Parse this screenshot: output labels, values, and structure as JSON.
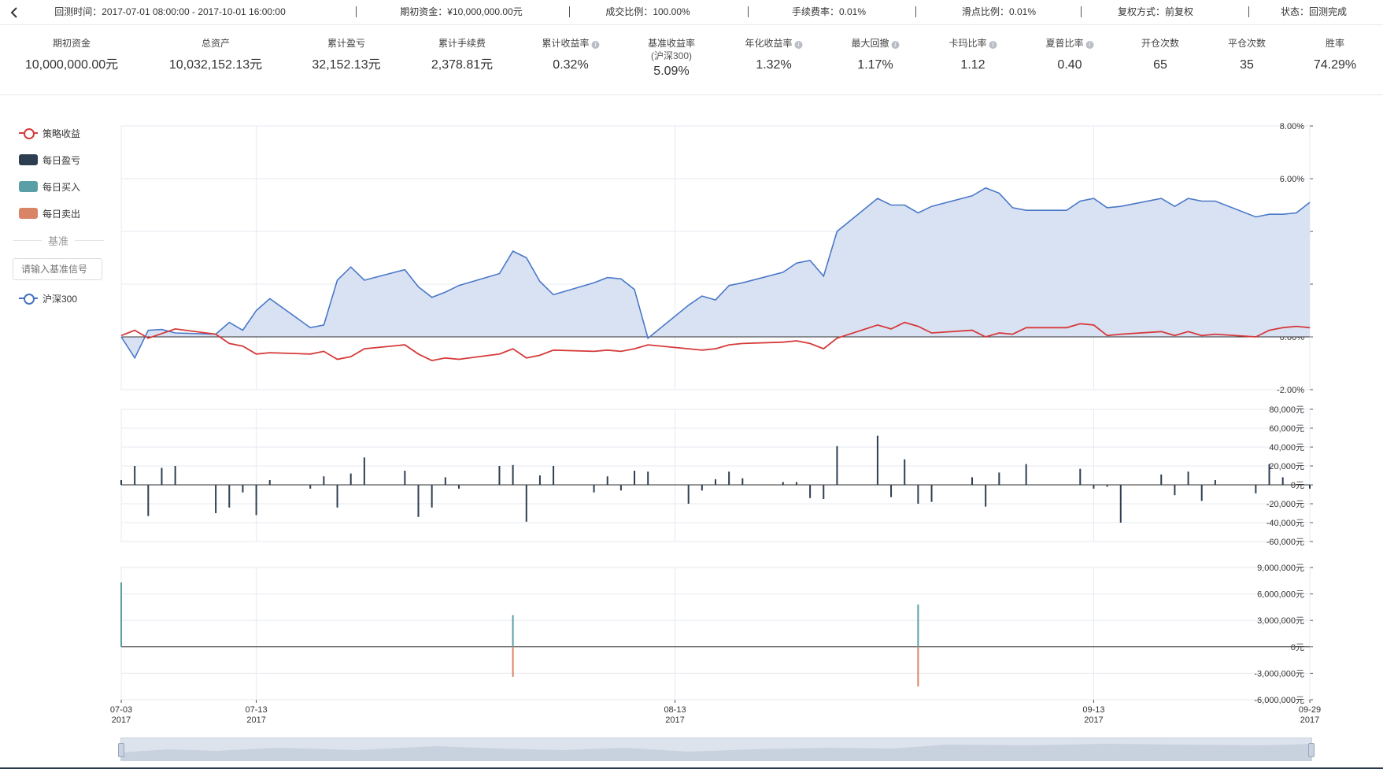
{
  "top_bar": {
    "back_icon": "chevron-left-icon",
    "items": [
      {
        "label": "回测时间：2017-07-01 08:00:00 - 2017-10-01 16:00:00"
      },
      {
        "label": "期初资金：¥10,000,000.00元"
      },
      {
        "label": "成交比例：100.00%"
      },
      {
        "label": "手续费率：0.01%"
      },
      {
        "label": "滑点比例：0.01%"
      },
      {
        "label": "复权方式：前复权"
      },
      {
        "label": "状态：回测完成"
      }
    ]
  },
  "stats": [
    {
      "label": "期初资金",
      "value": "10,000,000.00元"
    },
    {
      "label": "总资产",
      "value": "10,032,152.13元"
    },
    {
      "label": "累计盈亏",
      "value": "32,152.13元"
    },
    {
      "label": "累计手续费",
      "value": "2,378.81元"
    },
    {
      "label": "累计收益率",
      "value": "0.32%",
      "info_icon": true
    },
    {
      "label": "基准收益率",
      "sublabel": "(沪深300)",
      "value": "5.09%"
    },
    {
      "label": "年化收益率",
      "value": "1.32%",
      "info_icon": true
    },
    {
      "label": "最大回撤",
      "value": "1.17%",
      "info_icon": true
    },
    {
      "label": "卡玛比率",
      "value": "1.12",
      "info_icon": true
    },
    {
      "label": "夏普比率",
      "value": "0.40",
      "info_icon": true
    },
    {
      "label": "开仓次数",
      "value": "65"
    },
    {
      "label": "平仓次数",
      "value": "35"
    },
    {
      "label": "胜率",
      "value": "74.29%"
    }
  ],
  "legend": {
    "items": [
      {
        "label": "策略收益",
        "kind": "line",
        "color": "#d63a3a"
      },
      {
        "label": "每日盈亏",
        "kind": "box",
        "color": "#2c3e50"
      },
      {
        "label": "每日买入",
        "kind": "box",
        "color": "#5a9fa6"
      },
      {
        "label": "每日卖出",
        "kind": "box",
        "color": "#d98466"
      }
    ],
    "benchmark_title": "基准",
    "benchmark_placeholder": "请输入基准信号",
    "benchmark_item": {
      "label": "沪深300",
      "color": "#4472c4"
    }
  },
  "colors": {
    "strategy": "#d63a3a",
    "benchmark": "#4a78c8",
    "benchmark_fill": "#d9e2f3",
    "daily_pnl": "#2c3e50",
    "buy": "#5a9fa6",
    "sell": "#d98466",
    "grid": "#e6eaf0"
  },
  "chart_data": [
    {
      "type": "area",
      "title": "",
      "x_range": [
        "2017-07-03",
        "2017-09-29"
      ],
      "x_ticks": [
        {
          "date": "2017-07-03",
          "label1": "07-03",
          "label2": "2017"
        },
        {
          "date": "2017-07-13",
          "label1": "07-13",
          "label2": "2017"
        },
        {
          "date": "2017-08-13",
          "label1": "08-13",
          "label2": "2017"
        },
        {
          "date": "2017-09-13",
          "label1": "09-13",
          "label2": "2017"
        },
        {
          "date": "2017-09-29",
          "label1": "09-29",
          "label2": "2017"
        }
      ],
      "ylim": [
        -2,
        8
      ],
      "y_ticks": [
        "8.00%",
        "6.00%",
        "4.00%",
        "2.00%",
        "0.00%",
        "-2.00%"
      ],
      "y_tick_values": [
        8,
        6,
        4,
        2,
        0,
        -2
      ],
      "grid": true,
      "series": [
        {
          "name": "沪深300",
          "type": "area",
          "points": [
            [
              "2017-07-03",
              0.0
            ],
            [
              "2017-07-04",
              -0.8
            ],
            [
              "2017-07-05",
              0.25
            ],
            [
              "2017-07-06",
              0.28
            ],
            [
              "2017-07-07",
              0.15
            ],
            [
              "2017-07-10",
              0.1
            ],
            [
              "2017-07-11",
              0.55
            ],
            [
              "2017-07-12",
              0.25
            ],
            [
              "2017-07-13",
              1.0
            ],
            [
              "2017-07-14",
              1.45
            ],
            [
              "2017-07-17",
              0.35
            ],
            [
              "2017-07-18",
              0.45
            ],
            [
              "2017-07-19",
              2.15
            ],
            [
              "2017-07-20",
              2.65
            ],
            [
              "2017-07-21",
              2.15
            ],
            [
              "2017-07-24",
              2.55
            ],
            [
              "2017-07-25",
              1.9
            ],
            [
              "2017-07-26",
              1.5
            ],
            [
              "2017-07-27",
              1.7
            ],
            [
              "2017-07-28",
              1.95
            ],
            [
              "2017-07-31",
              2.4
            ],
            [
              "2017-08-01",
              3.25
            ],
            [
              "2017-08-02",
              3.0
            ],
            [
              "2017-08-03",
              2.1
            ],
            [
              "2017-08-04",
              1.6
            ],
            [
              "2017-08-07",
              2.05
            ],
            [
              "2017-08-08",
              2.25
            ],
            [
              "2017-08-09",
              2.2
            ],
            [
              "2017-08-10",
              1.8
            ],
            [
              "2017-08-11",
              -0.05
            ],
            [
              "2017-08-14",
              1.2
            ],
            [
              "2017-08-15",
              1.55
            ],
            [
              "2017-08-16",
              1.4
            ],
            [
              "2017-08-17",
              1.95
            ],
            [
              "2017-08-18",
              2.05
            ],
            [
              "2017-08-21",
              2.45
            ],
            [
              "2017-08-22",
              2.8
            ],
            [
              "2017-08-23",
              2.9
            ],
            [
              "2017-08-24",
              2.3
            ],
            [
              "2017-08-25",
              4.0
            ],
            [
              "2017-08-28",
              5.25
            ],
            [
              "2017-08-29",
              5.0
            ],
            [
              "2017-08-30",
              5.0
            ],
            [
              "2017-08-31",
              4.7
            ],
            [
              "2017-09-01",
              4.95
            ],
            [
              "2017-09-04",
              5.35
            ],
            [
              "2017-09-05",
              5.65
            ],
            [
              "2017-09-06",
              5.45
            ],
            [
              "2017-09-07",
              4.9
            ],
            [
              "2017-09-08",
              4.8
            ],
            [
              "2017-09-11",
              4.8
            ],
            [
              "2017-09-12",
              5.15
            ],
            [
              "2017-09-13",
              5.25
            ],
            [
              "2017-09-14",
              4.9
            ],
            [
              "2017-09-15",
              4.95
            ],
            [
              "2017-09-18",
              5.25
            ],
            [
              "2017-09-19",
              4.95
            ],
            [
              "2017-09-20",
              5.25
            ],
            [
              "2017-09-21",
              5.15
            ],
            [
              "2017-09-22",
              5.15
            ],
            [
              "2017-09-25",
              4.55
            ],
            [
              "2017-09-26",
              4.65
            ],
            [
              "2017-09-27",
              4.65
            ],
            [
              "2017-09-28",
              4.7
            ],
            [
              "2017-09-29",
              5.1
            ]
          ]
        },
        {
          "name": "策略收益",
          "type": "line",
          "points": [
            [
              "2017-07-03",
              0.05
            ],
            [
              "2017-07-04",
              0.25
            ],
            [
              "2017-07-05",
              -0.05
            ],
            [
              "2017-07-07",
              0.3
            ],
            [
              "2017-07-10",
              0.1
            ],
            [
              "2017-07-11",
              -0.25
            ],
            [
              "2017-07-12",
              -0.35
            ],
            [
              "2017-07-13",
              -0.65
            ],
            [
              "2017-07-14",
              -0.6
            ],
            [
              "2017-07-17",
              -0.65
            ],
            [
              "2017-07-18",
              -0.55
            ],
            [
              "2017-07-19",
              -0.85
            ],
            [
              "2017-07-20",
              -0.75
            ],
            [
              "2017-07-21",
              -0.45
            ],
            [
              "2017-07-24",
              -0.3
            ],
            [
              "2017-07-25",
              -0.65
            ],
            [
              "2017-07-26",
              -0.9
            ],
            [
              "2017-07-27",
              -0.8
            ],
            [
              "2017-07-28",
              -0.85
            ],
            [
              "2017-07-31",
              -0.65
            ],
            [
              "2017-08-01",
              -0.45
            ],
            [
              "2017-08-02",
              -0.8
            ],
            [
              "2017-08-03",
              -0.7
            ],
            [
              "2017-08-04",
              -0.5
            ],
            [
              "2017-08-07",
              -0.55
            ],
            [
              "2017-08-08",
              -0.5
            ],
            [
              "2017-08-09",
              -0.55
            ],
            [
              "2017-08-10",
              -0.45
            ],
            [
              "2017-08-11",
              -0.3
            ],
            [
              "2017-08-14",
              -0.45
            ],
            [
              "2017-08-15",
              -0.5
            ],
            [
              "2017-08-16",
              -0.45
            ],
            [
              "2017-08-17",
              -0.3
            ],
            [
              "2017-08-18",
              -0.25
            ],
            [
              "2017-08-21",
              -0.2
            ],
            [
              "2017-08-22",
              -0.15
            ],
            [
              "2017-08-23",
              -0.25
            ],
            [
              "2017-08-24",
              -0.45
            ],
            [
              "2017-08-25",
              -0.05
            ],
            [
              "2017-08-28",
              0.45
            ],
            [
              "2017-08-29",
              0.3
            ],
            [
              "2017-08-30",
              0.55
            ],
            [
              "2017-08-31",
              0.4
            ],
            [
              "2017-09-01",
              0.15
            ],
            [
              "2017-09-04",
              0.25
            ],
            [
              "2017-09-05",
              0.0
            ],
            [
              "2017-09-06",
              0.15
            ],
            [
              "2017-09-07",
              0.1
            ],
            [
              "2017-09-08",
              0.35
            ],
            [
              "2017-09-11",
              0.35
            ],
            [
              "2017-09-12",
              0.5
            ],
            [
              "2017-09-13",
              0.45
            ],
            [
              "2017-09-14",
              0.05
            ],
            [
              "2017-09-15",
              0.1
            ],
            [
              "2017-09-18",
              0.2
            ],
            [
              "2017-09-19",
              0.05
            ],
            [
              "2017-09-20",
              0.2
            ],
            [
              "2017-09-21",
              0.05
            ],
            [
              "2017-09-22",
              0.1
            ],
            [
              "2017-09-25",
              0.0
            ],
            [
              "2017-09-26",
              0.25
            ],
            [
              "2017-09-27",
              0.35
            ],
            [
              "2017-09-28",
              0.4
            ],
            [
              "2017-09-29",
              0.35
            ]
          ]
        }
      ]
    },
    {
      "type": "bar",
      "name": "每日盈亏",
      "ylim": [
        -60000,
        80000
      ],
      "y_ticks": [
        "80,000元",
        "60,000元",
        "40,000元",
        "20,000元",
        "0元",
        "-20,000元",
        "-40,000元",
        "-60,000元"
      ],
      "y_tick_values": [
        80000,
        60000,
        40000,
        20000,
        0,
        -20000,
        -40000,
        -60000
      ],
      "points": [
        [
          "2017-07-03",
          5000
        ],
        [
          "2017-07-04",
          20000
        ],
        [
          "2017-07-05",
          -33000
        ],
        [
          "2017-07-06",
          18000
        ],
        [
          "2017-07-07",
          20000
        ],
        [
          "2017-07-10",
          -30000
        ],
        [
          "2017-07-11",
          -24000
        ],
        [
          "2017-07-12",
          -8000
        ],
        [
          "2017-07-13",
          -32000
        ],
        [
          "2017-07-14",
          5000
        ],
        [
          "2017-07-17",
          -4000
        ],
        [
          "2017-07-18",
          9000
        ],
        [
          "2017-07-19",
          -24000
        ],
        [
          "2017-07-20",
          12000
        ],
        [
          "2017-07-21",
          29000
        ],
        [
          "2017-07-24",
          15000
        ],
        [
          "2017-07-25",
          -34000
        ],
        [
          "2017-07-26",
          -24000
        ],
        [
          "2017-07-27",
          8000
        ],
        [
          "2017-07-28",
          -4000
        ],
        [
          "2017-07-31",
          20000
        ],
        [
          "2017-08-01",
          21000
        ],
        [
          "2017-08-02",
          -39000
        ],
        [
          "2017-08-03",
          10000
        ],
        [
          "2017-08-04",
          20000
        ],
        [
          "2017-08-07",
          -8000
        ],
        [
          "2017-08-08",
          9000
        ],
        [
          "2017-08-09",
          -6000
        ],
        [
          "2017-08-10",
          15000
        ],
        [
          "2017-08-11",
          14000
        ],
        [
          "2017-08-14",
          -20000
        ],
        [
          "2017-08-15",
          -6000
        ],
        [
          "2017-08-16",
          6000
        ],
        [
          "2017-08-17",
          14000
        ],
        [
          "2017-08-18",
          7000
        ],
        [
          "2017-08-21",
          3000
        ],
        [
          "2017-08-22",
          3000
        ],
        [
          "2017-08-23",
          -14000
        ],
        [
          "2017-08-24",
          -15000
        ],
        [
          "2017-08-25",
          41000
        ],
        [
          "2017-08-28",
          52000
        ],
        [
          "2017-08-29",
          -13000
        ],
        [
          "2017-08-30",
          27000
        ],
        [
          "2017-08-31",
          -20000
        ],
        [
          "2017-09-01",
          -18000
        ],
        [
          "2017-09-04",
          8000
        ],
        [
          "2017-09-05",
          -23000
        ],
        [
          "2017-09-06",
          13000
        ],
        [
          "2017-09-08",
          22000
        ],
        [
          "2017-09-12",
          17000
        ],
        [
          "2017-09-13",
          -4000
        ],
        [
          "2017-09-14",
          -2000
        ],
        [
          "2017-09-15",
          -40000
        ],
        [
          "2017-09-18",
          11000
        ],
        [
          "2017-09-19",
          -11000
        ],
        [
          "2017-09-20",
          14000
        ],
        [
          "2017-09-21",
          -17000
        ],
        [
          "2017-09-22",
          5000
        ],
        [
          "2017-09-25",
          -9000
        ],
        [
          "2017-09-26",
          22000
        ],
        [
          "2017-09-27",
          8000
        ],
        [
          "2017-09-29",
          -4000
        ]
      ]
    },
    {
      "type": "bar",
      "name": "每日买入 / 每日卖出",
      "ylim": [
        -6000000,
        9000000
      ],
      "y_ticks": [
        "9,000,000元",
        "6,000,000元",
        "3,000,000元",
        "0元",
        "-3,000,000元",
        "-6,000,000元"
      ],
      "y_tick_values": [
        9000000,
        6000000,
        3000000,
        0,
        -3000000,
        -6000000
      ],
      "series": [
        {
          "name": "每日买入",
          "points": [
            [
              "2017-07-03",
              7300000
            ],
            [
              "2017-08-01",
              3600000
            ],
            [
              "2017-08-31",
              4800000
            ]
          ]
        },
        {
          "name": "每日卖出",
          "points": [
            [
              "2017-08-01",
              -3400000
            ],
            [
              "2017-08-31",
              -4500000
            ]
          ]
        }
      ]
    }
  ]
}
